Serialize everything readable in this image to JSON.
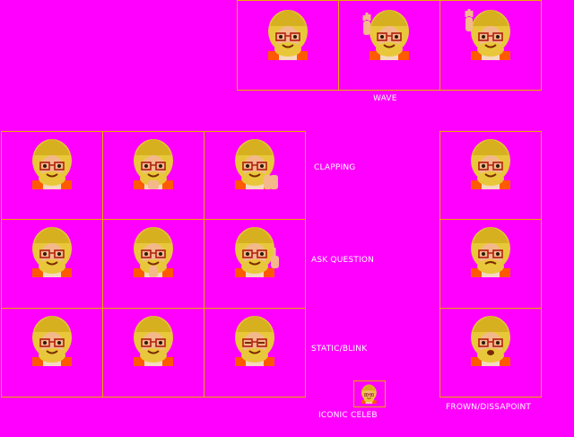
{
  "labels": {
    "wave": "WAVE",
    "clapping": "CLAPPING",
    "ask_question": "ASK QUESTION",
    "static_blink": "STATIC/BLINK",
    "iconic_celeb": "ICONIC CELEB",
    "frown": "FROWN/DISSAPOINT"
  },
  "colors": {
    "background": "#ff00ff",
    "grid_line": "#e8a800",
    "hair": "#e8c83a",
    "skin": "#f3b98a",
    "shirt": "#ff5a00",
    "text": "#ffffff"
  },
  "sprite_sheet": {
    "wave": [
      "neutral",
      "wave-hand-left",
      "wave-hand-up"
    ],
    "main_grid": [
      [
        "neutral",
        "clap-start",
        "clap-together"
      ],
      [
        "neutral",
        "point-chin",
        "raise-finger"
      ],
      [
        "neutral",
        "smile",
        "blink"
      ]
    ],
    "frown": [
      "neutral",
      "frown",
      "open-mouth"
    ]
  }
}
